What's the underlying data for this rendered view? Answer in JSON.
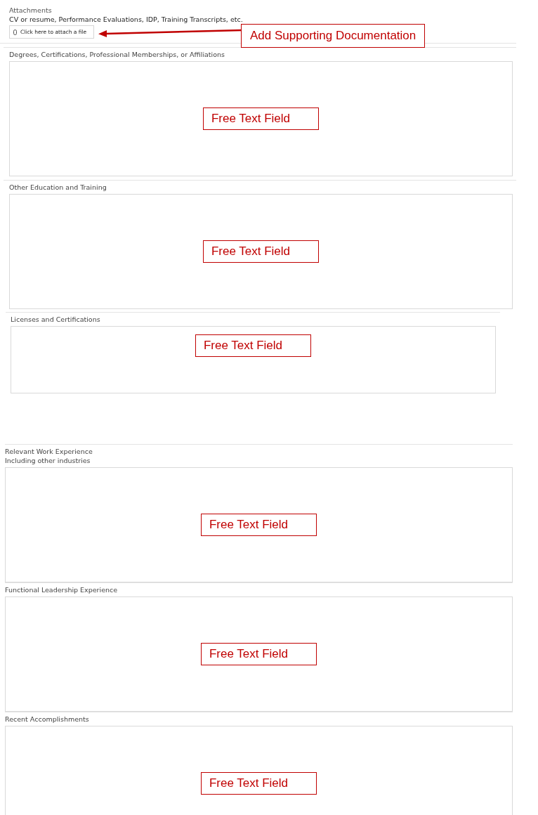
{
  "attachments": {
    "title": "Attachments",
    "hint": "CV or resume, Performance Evaluations, IDP, Training Transcripts, etc.",
    "button": "Click here to attach a file",
    "callout": "Add Supporting Documentation"
  },
  "upper_sections": [
    {
      "label": "Degrees, Certifications, Professional Memberships, or Affiliations",
      "annotation": "Free Text Field"
    },
    {
      "label": "Other Education and Training",
      "annotation": "Free Text Field"
    },
    {
      "label": "Licenses and Certifications",
      "annotation": "Free Text Field"
    }
  ],
  "lower_sections": [
    {
      "label": "Relevant Work Experience",
      "sublabel": "Including other industries",
      "annotation": "Free Text Field"
    },
    {
      "label": "Functional Leadership Experience",
      "annotation": "Free Text Field"
    },
    {
      "label": "Recent Accomplishments",
      "annotation": "Free Text Field"
    }
  ]
}
